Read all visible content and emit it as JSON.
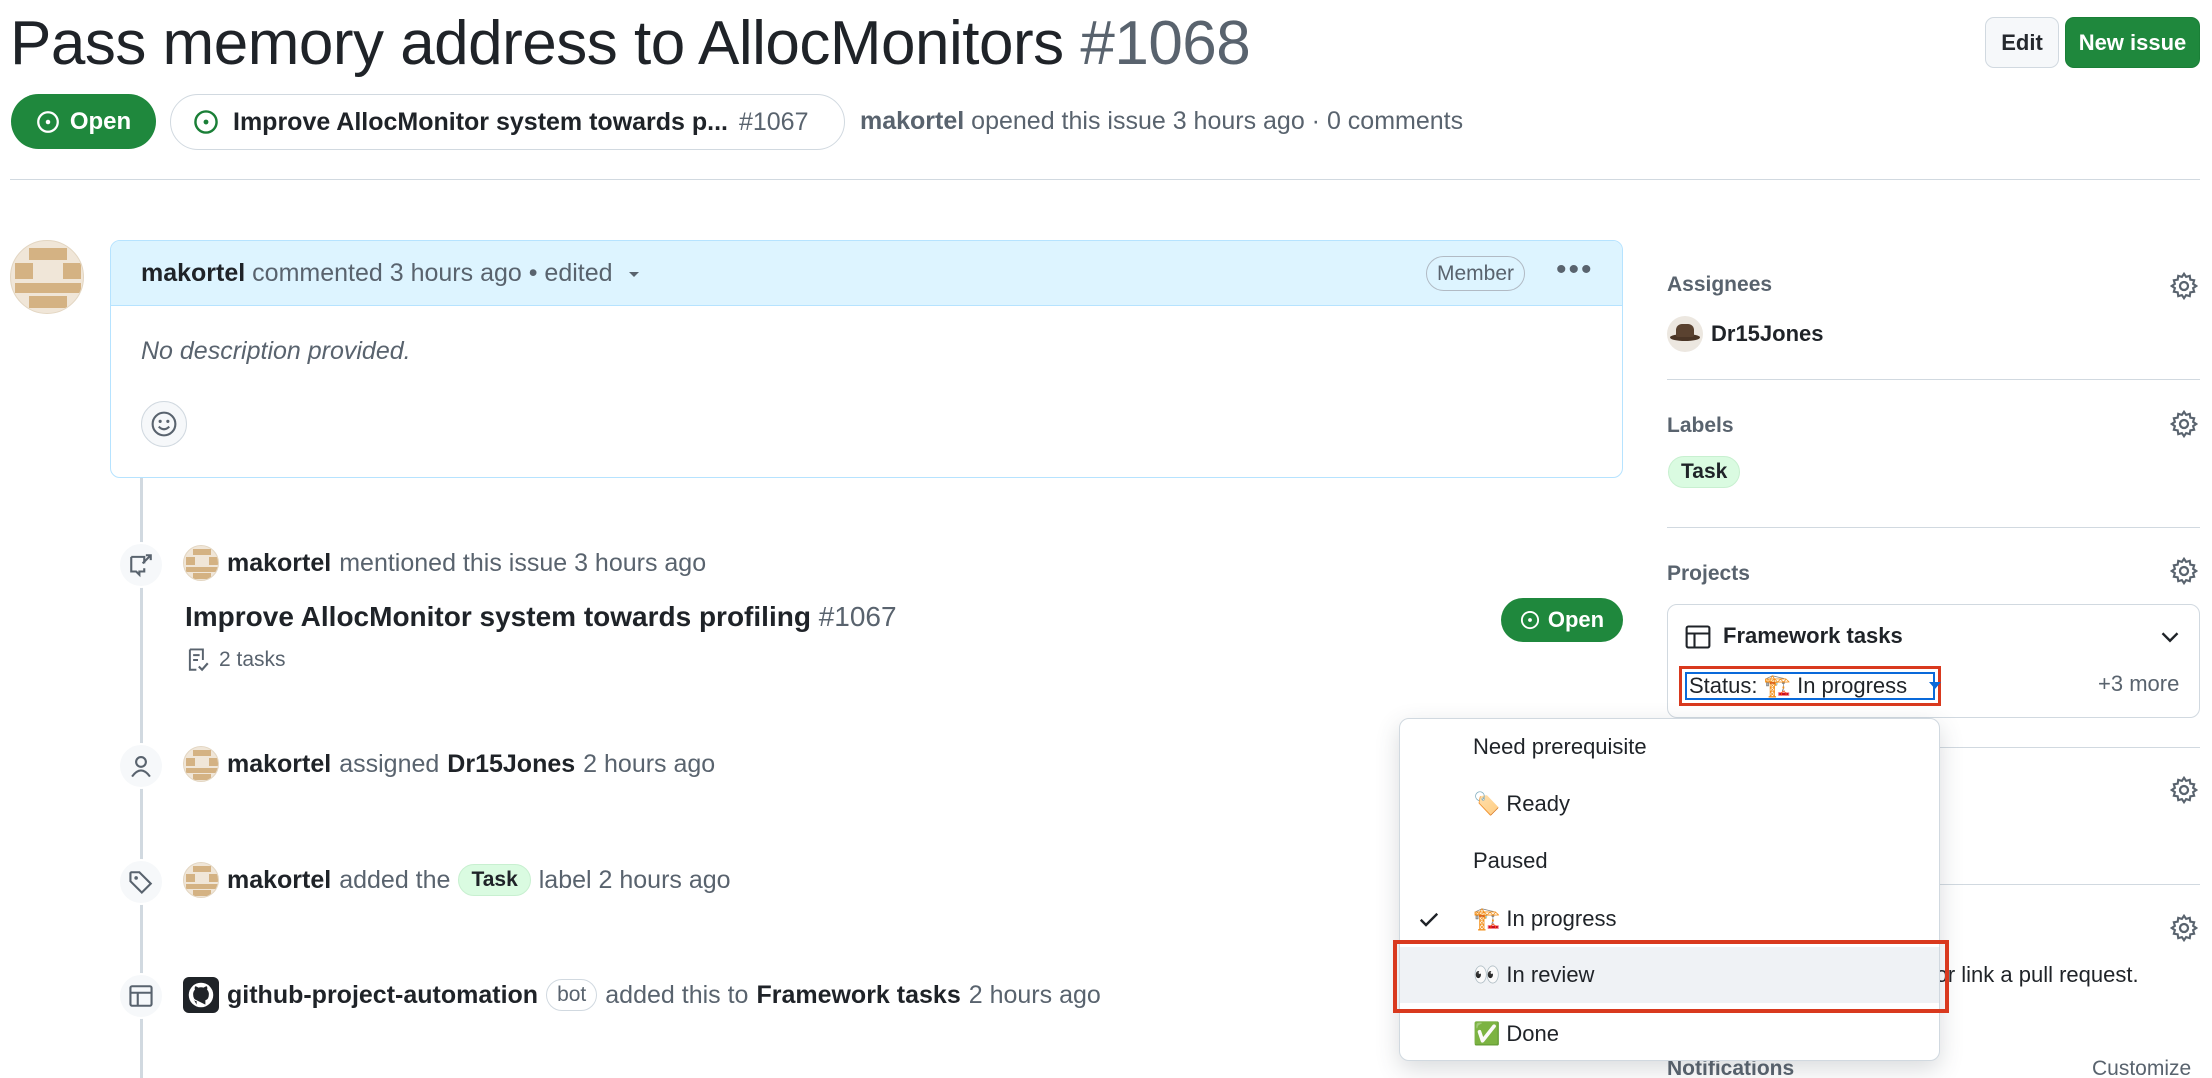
{
  "header": {
    "title": "Pass memory address to AllocMonitors",
    "number": "#1068",
    "edit_label": "Edit",
    "new_issue_label": "New issue",
    "state_label": "Open",
    "parent_title": "Improve AllocMonitor system towards p...",
    "parent_number": "#1067",
    "meta_author": "makortel",
    "meta_text": "opened this issue 3 hours ago · 0 comments"
  },
  "comment": {
    "author": "makortel",
    "action": "commented 3 hours ago",
    "edited": "• edited",
    "role_badge": "Member",
    "body": "No description provided."
  },
  "timeline": {
    "mention": {
      "actor": "makortel",
      "text": "mentioned this issue 3 hours ago",
      "ref_title": "Improve AllocMonitor system towards profiling",
      "ref_number": "#1067",
      "tasks": "2 tasks",
      "state": "Open"
    },
    "assigned": {
      "actor": "makortel",
      "verb": "assigned",
      "target": "Dr15Jones",
      "time": "2 hours ago"
    },
    "labeled": {
      "actor": "makortel",
      "pre": "added the",
      "label": "Task",
      "post": "label 2 hours ago"
    },
    "project": {
      "actor": "github-project-automation",
      "badge": "bot",
      "pre": "added this to",
      "project": "Framework tasks",
      "time": "2 hours ago"
    }
  },
  "sidebar": {
    "assignees_heading": "Assignees",
    "assignee": "Dr15Jones",
    "labels_heading": "Labels",
    "label": "Task",
    "projects_heading": "Projects",
    "project_name": "Framework tasks",
    "status_text": "Status: 🏗️ In progress",
    "more": "+3 more",
    "dev_text": "ue or link a pull request.",
    "notifications_heading": "Notifications",
    "customize": "Customize"
  },
  "dropdown": {
    "options": [
      {
        "label": "Need prerequisite",
        "icon": ""
      },
      {
        "label": "Ready",
        "icon": "🏷️"
      },
      {
        "label": "Paused",
        "icon": ""
      },
      {
        "label": "In progress",
        "icon": "🏗️",
        "selected": true
      },
      {
        "label": "In review",
        "icon": "👀",
        "highlighted": true
      },
      {
        "label": "Done",
        "icon": "✅"
      }
    ]
  },
  "colors": {
    "accent_green": "#1f883d",
    "highlight_red": "#d9391e",
    "focus_blue": "#0969da"
  }
}
